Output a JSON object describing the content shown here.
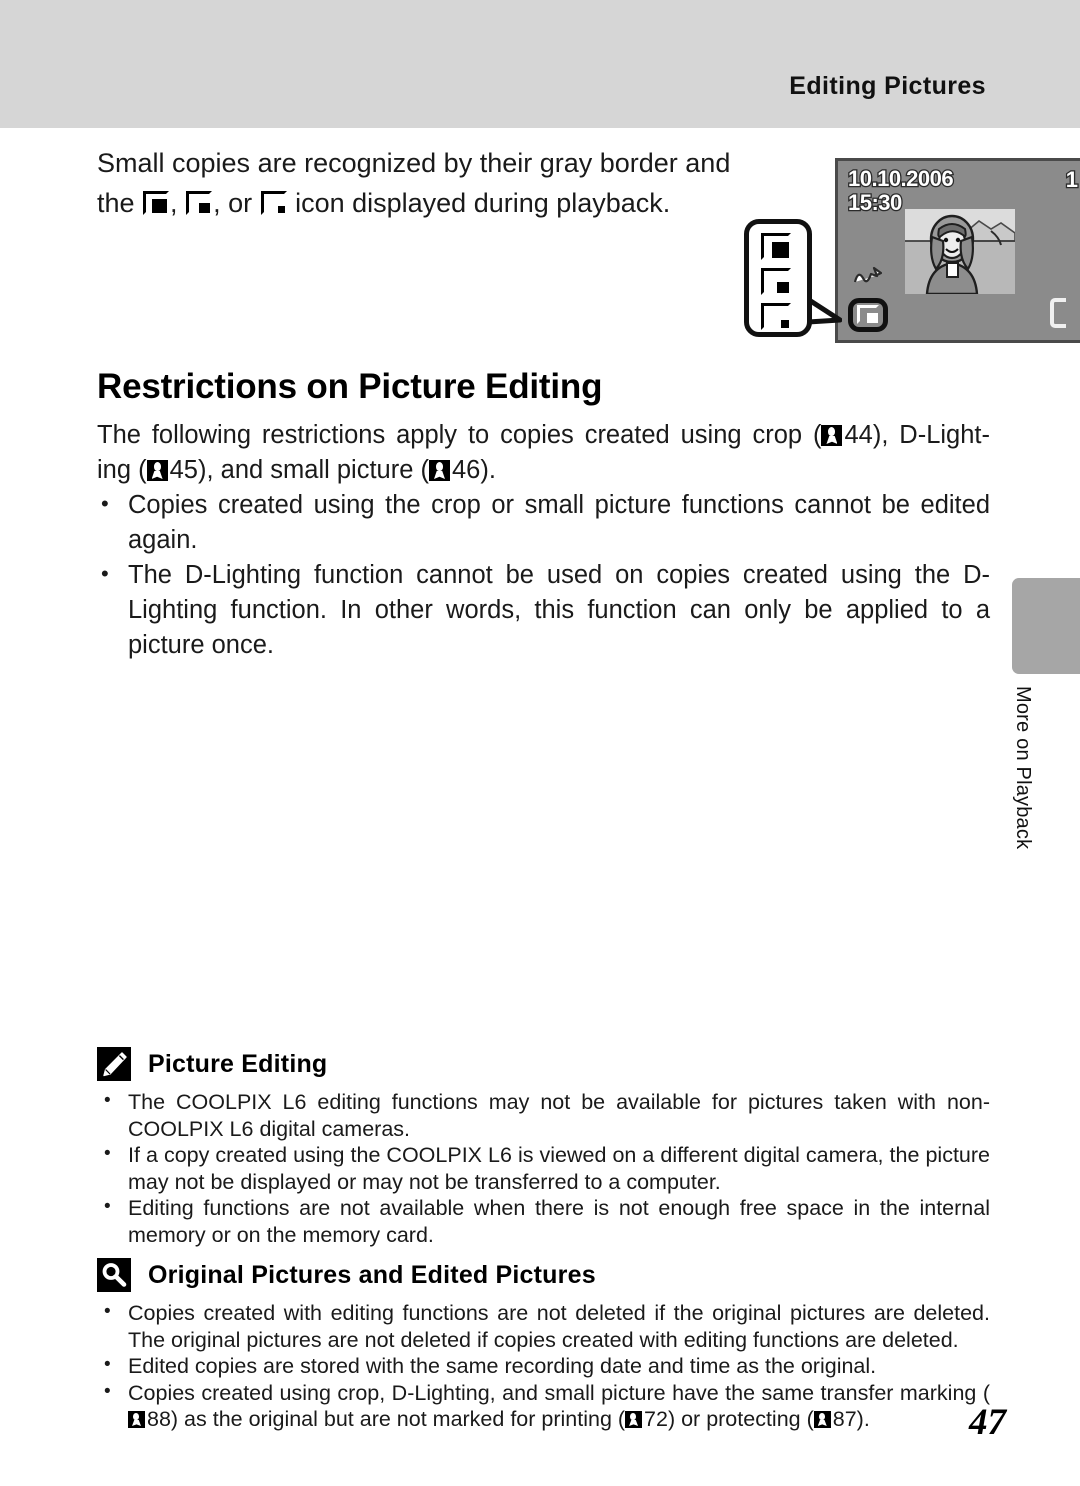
{
  "header": {
    "title": "Editing Pictures"
  },
  "side_tab": {
    "label": "More on Playback",
    "color": "#a6a6a6"
  },
  "intro": {
    "line1": "Small copies are recognized by their gray border and",
    "line2_before": "the ",
    "line2_mid1": ", ",
    "line2_mid2": ", or ",
    "line2_after": " icon displayed during playback.",
    "icons": [
      "small-picture-large-icon",
      "small-picture-medium-icon",
      "small-picture-small-icon"
    ]
  },
  "illustration": {
    "name": "camera-lcd-playback-illustration",
    "lcd": {
      "date": "10.10.2006",
      "time": "15:30",
      "clipped_digit": "1",
      "transfer_mark_icon": "transfer-marking-icon",
      "small_picture_icon": "small-picture-icon",
      "bracket_icon": "bracket-icon"
    },
    "callout": {
      "icons": [
        "small-picture-large-icon",
        "small-picture-medium-icon",
        "small-picture-small-icon"
      ]
    }
  },
  "section": {
    "title": "Restrictions on Picture Editing",
    "lead": {
      "t1": "The following restrictions apply to copies created using crop (",
      "r1": "44",
      "t2": "), D-Light-",
      "t3": "ing (",
      "r2": "45",
      "t4": "), and small picture (",
      "r3": "46",
      "t5": ")."
    },
    "bullets": [
      "Copies created using the crop or small picture functions cannot be edited again.",
      "The D-Lighting function cannot be used on copies created using the D-Lighting function. In other words, this function can only be applied to a picture once."
    ]
  },
  "notes": [
    {
      "icon": "pencil-icon",
      "title": "Picture Editing",
      "bullets": [
        "The COOLPIX L6 editing functions may not be available for pictures taken with non-COOLPIX L6 digital cameras.",
        "If a copy created using the COOLPIX L6 is viewed on a different digital camera, the picture may not be displayed or may not be transferred to a computer.",
        "Editing functions are not available when there is not enough free space in the internal memory or on the memory card."
      ]
    },
    {
      "icon": "magnifier-icon",
      "title": "Original Pictures and Edited Pictures",
      "bullets": [
        "Copies created with editing functions are not deleted if the original pictures are deleted. The original pictures are not deleted if copies created with editing functions are deleted.",
        "Edited copies are stored with the same recording date and time as the original."
      ],
      "last_bullet": {
        "t1": "Copies created using crop, D-Lighting, and small picture have the same transfer marking (",
        "r1": "88",
        "t2": ") as the original but are not marked for printing (",
        "r2": "72",
        "t3": ") or protecting (",
        "r3": "87",
        "t4": ")."
      }
    }
  ],
  "page_number": "47"
}
